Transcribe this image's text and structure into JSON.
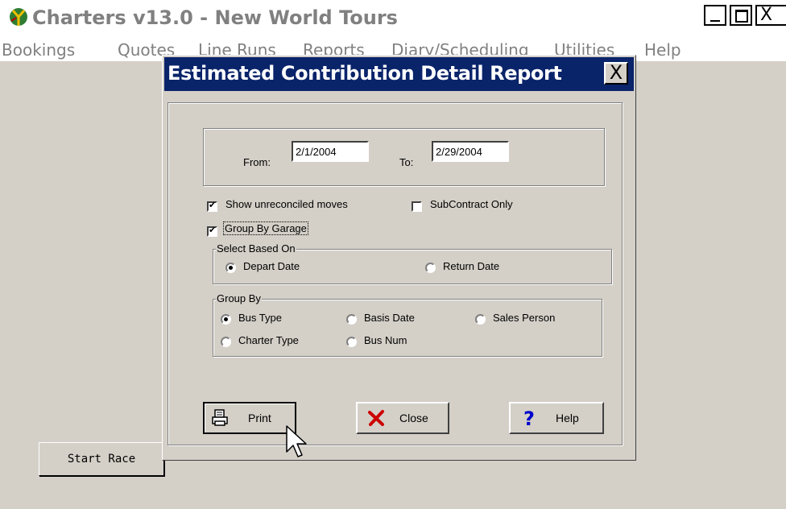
{
  "app": {
    "title": "Charters v13.0 - New World Tours",
    "close_glyph": "X",
    "menu": [
      "Bookings",
      "Quotes",
      "Line Runs",
      "Reports",
      "Diary/Scheduling",
      "Utilities",
      "Help"
    ],
    "start_race_label": "Start Race"
  },
  "dialog": {
    "title": "Estimated Contribution Detail Report",
    "close_glyph": "X",
    "from_label": "From:",
    "from_value": "2/1/2004",
    "to_label": "To:",
    "to_value": "2/29/2004",
    "show_unreconciled": {
      "label": "Show unreconciled moves",
      "checked": true
    },
    "subcontract_only": {
      "label": "SubContract Only",
      "checked": false
    },
    "group_by_garage": {
      "label": "Group By Garage",
      "checked": true
    },
    "select_based_on": {
      "legend": "Select Based On",
      "options": [
        {
          "label": "Depart Date",
          "selected": true
        },
        {
          "label": "Return Date",
          "selected": false
        }
      ]
    },
    "group_by": {
      "legend": "Group By",
      "options": [
        {
          "label": "Bus Type",
          "selected": true
        },
        {
          "label": "Basis Date",
          "selected": false
        },
        {
          "label": "Sales Person",
          "selected": false
        },
        {
          "label": "Charter Type",
          "selected": false
        },
        {
          "label": "Bus Num",
          "selected": false
        }
      ]
    },
    "buttons": {
      "print": "Print",
      "close": "Close",
      "help": "Help"
    }
  },
  "colors": {
    "dialog_titlebar": "#0a246a",
    "window_face": "#d4d0c8",
    "close_icon": "#cc0000",
    "help_icon": "#0000cc"
  }
}
